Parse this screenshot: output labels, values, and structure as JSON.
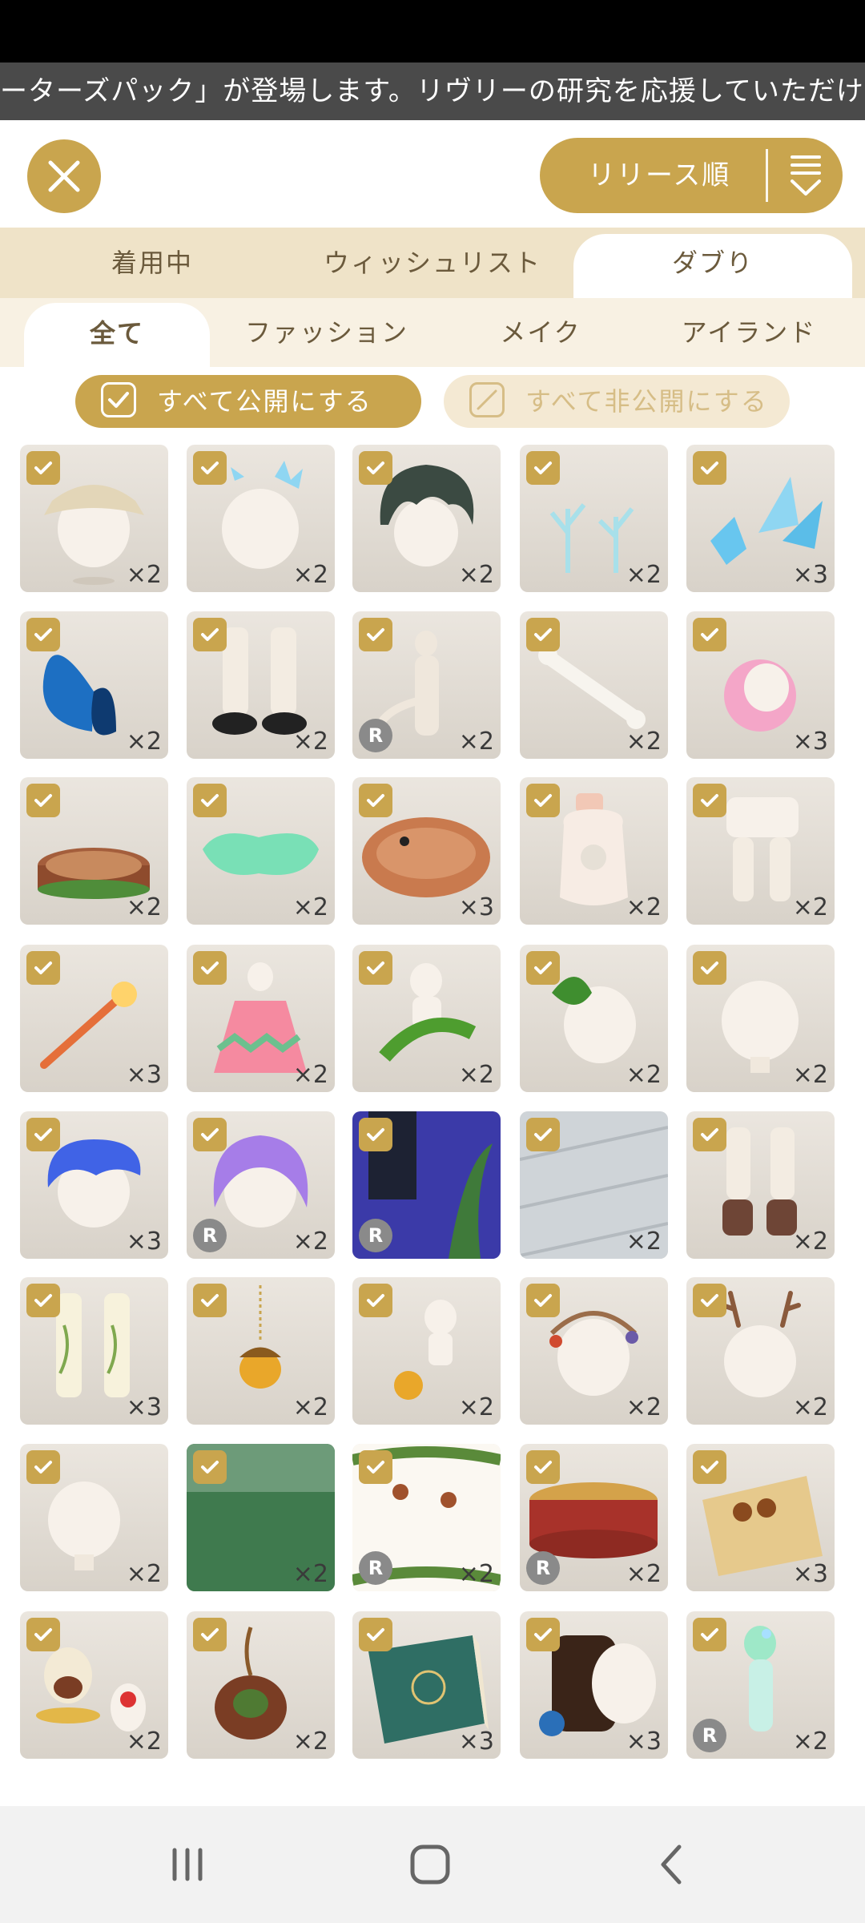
{
  "ticker": "ーターズパック」が登場します。リヴリーの研究を応援していただけ…",
  "header": {
    "sort_label": "リリース順"
  },
  "tabs": [
    "着用中",
    "ウィッシュリスト",
    "ダブり"
  ],
  "subtabs": [
    "全て",
    "ファッション",
    "メイク",
    "アイランド"
  ],
  "actions": {
    "public_all": "すべて公開にする",
    "private_all": "すべて非公開にする"
  },
  "colors": {
    "accent": "#c9a54e",
    "tab_bg": "#efe3c8",
    "subtab_bg": "#f8f1e3"
  },
  "items": [
    {
      "count": "×2",
      "r": false,
      "icon": "bucket-hat"
    },
    {
      "count": "×2",
      "r": false,
      "icon": "crystal-hair-clip"
    },
    {
      "count": "×2",
      "r": false,
      "icon": "dark-green-hair"
    },
    {
      "count": "×2",
      "r": false,
      "icon": "coral-decor"
    },
    {
      "count": "×3",
      "r": false,
      "icon": "ice-crystals"
    },
    {
      "count": "×2",
      "r": false,
      "icon": "blue-butterfly"
    },
    {
      "count": "×2",
      "r": false,
      "icon": "leg-warmer-shoes"
    },
    {
      "count": "×2",
      "r": true,
      "icon": "tail-bodysuit"
    },
    {
      "count": "×2",
      "r": false,
      "icon": "bone"
    },
    {
      "count": "×3",
      "r": false,
      "icon": "pink-curly-hair"
    },
    {
      "count": "×2",
      "r": false,
      "icon": "tree-stump"
    },
    {
      "count": "×2",
      "r": false,
      "icon": "green-puddle"
    },
    {
      "count": "×3",
      "r": false,
      "icon": "woven-nest"
    },
    {
      "count": "×2",
      "r": false,
      "icon": "perfume-bottle"
    },
    {
      "count": "×2",
      "r": false,
      "icon": "lace-shorts"
    },
    {
      "count": "×3",
      "r": false,
      "icon": "torch-wand"
    },
    {
      "count": "×2",
      "r": false,
      "icon": "zigzag-dress"
    },
    {
      "count": "×2",
      "r": false,
      "icon": "leaf-scarf"
    },
    {
      "count": "×2",
      "r": false,
      "icon": "leaf-headpiece"
    },
    {
      "count": "×2",
      "r": false,
      "icon": "plain-head"
    },
    {
      "count": "×3",
      "r": false,
      "icon": "blue-hair"
    },
    {
      "count": "×2",
      "r": true,
      "icon": "purple-hair"
    },
    {
      "count": "",
      "r": true,
      "icon": "night-window-background"
    },
    {
      "count": "×2",
      "r": false,
      "icon": "wood-floor"
    },
    {
      "count": "×2",
      "r": false,
      "icon": "brown-boots"
    },
    {
      "count": "×3",
      "r": false,
      "icon": "ivy-stockings"
    },
    {
      "count": "×2",
      "r": false,
      "icon": "acorn-pendant"
    },
    {
      "count": "×2",
      "r": false,
      "icon": "acorn-necklace"
    },
    {
      "count": "×2",
      "r": false,
      "icon": "berry-wreath"
    },
    {
      "count": "×2",
      "r": false,
      "icon": "antlers"
    },
    {
      "count": "×2",
      "r": false,
      "icon": "plain-head-small"
    },
    {
      "count": "×2",
      "r": false,
      "icon": "forest-background"
    },
    {
      "count": "×2",
      "r": true,
      "icon": "hanging-fruit-frame"
    },
    {
      "count": "×2",
      "r": true,
      "icon": "ornate-tray"
    },
    {
      "count": "×3",
      "r": false,
      "icon": "old-map"
    },
    {
      "count": "×2",
      "r": false,
      "icon": "cake-stand"
    },
    {
      "count": "×2",
      "r": false,
      "icon": "acorn-bag"
    },
    {
      "count": "×3",
      "r": false,
      "icon": "green-book"
    },
    {
      "count": "×3",
      "r": false,
      "icon": "backpack"
    },
    {
      "count": "×2",
      "r": true,
      "icon": "iridescent-doll"
    }
  ]
}
